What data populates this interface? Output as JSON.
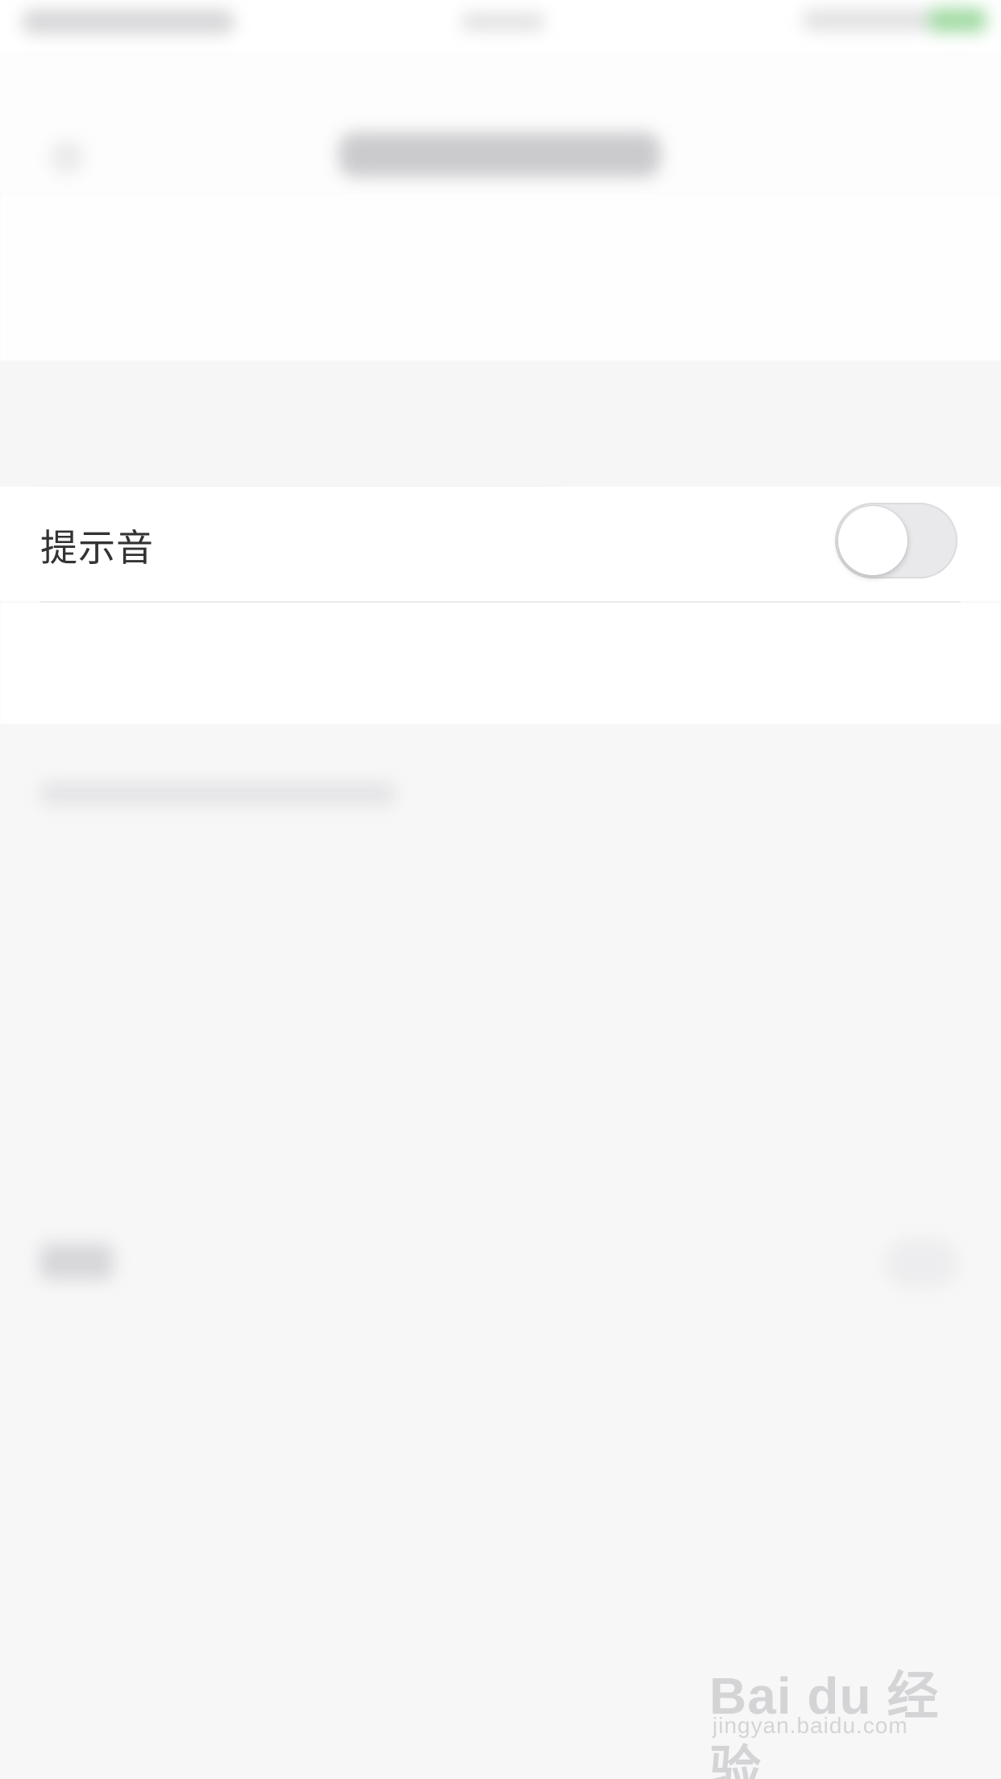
{
  "settings_row": {
    "label": "提示音",
    "toggle_state": "off"
  },
  "watermark": {
    "brand": "Bai du 经验",
    "url": "jingyan.baidu.com"
  },
  "colors": {
    "background": "#f7f7f8",
    "row_background": "#ffffff",
    "label_text": "#333333",
    "toggle_off": "#e9e9ec",
    "status_battery": "#8bd28e"
  }
}
